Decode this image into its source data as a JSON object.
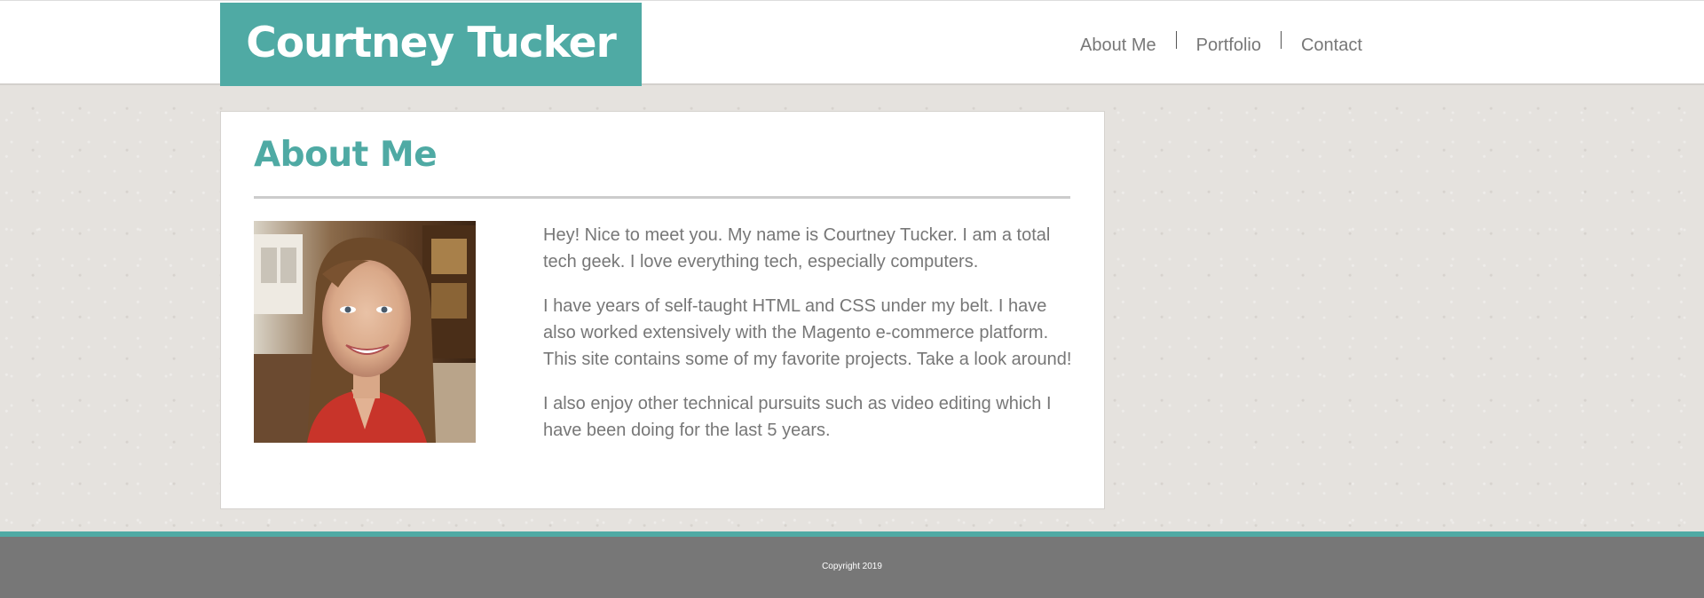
{
  "header": {
    "site_title": "Courtney Tucker",
    "nav": [
      {
        "label": "About Me"
      },
      {
        "label": "Portfolio"
      },
      {
        "label": "Contact"
      }
    ]
  },
  "main": {
    "title": "About Me",
    "photo_icon": "profile-photo",
    "paragraphs": [
      "Hey! Nice to meet you. My name is Courtney Tucker. I am a total tech geek. I love everything tech, especially computers.",
      "I have years of self-taught HTML and CSS under my belt. I have also worked extensively with the Magento e-commerce platform. This site contains some of my favorite projects. Take a look around!",
      "I also enjoy other technical pursuits such as video editing which I have been doing for the last 5 years."
    ]
  },
  "footer": {
    "copyright": "Copyright 2019"
  },
  "colors": {
    "accent": "#4faaa4",
    "text": "#777777",
    "footer_bg": "#777777",
    "page_bg": "#e5e2de"
  }
}
